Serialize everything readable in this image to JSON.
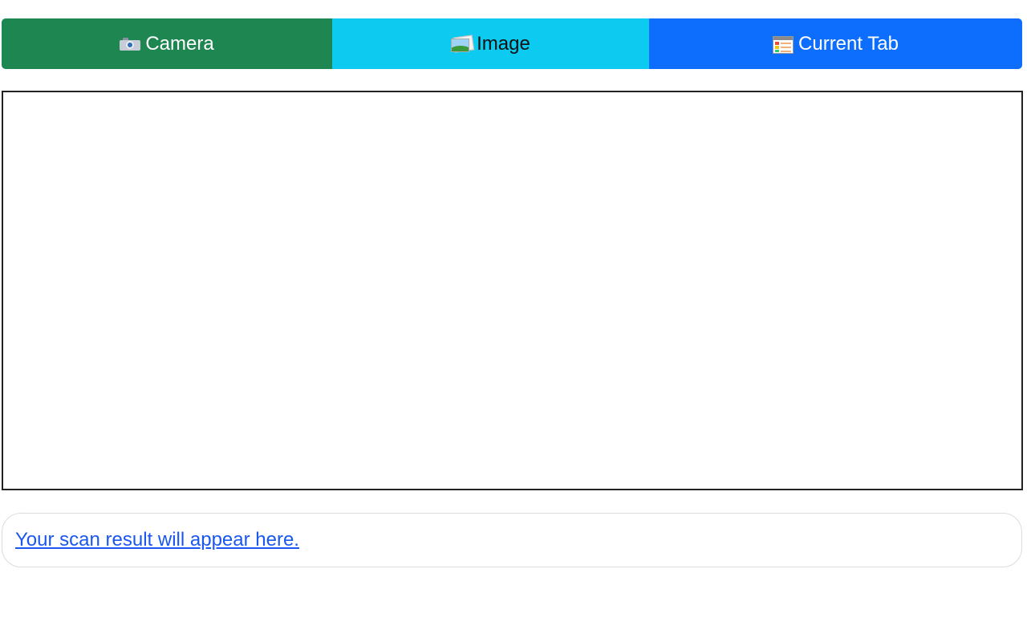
{
  "toolbar": {
    "camera": {
      "label": "Camera",
      "icon": "camera-icon",
      "color": "#1e8650",
      "text_color": "#ffffff"
    },
    "image": {
      "label": "Image",
      "icon": "image-icon",
      "color": "#0dcaf0",
      "text_color": "#111111"
    },
    "current_tab": {
      "label": "Current Tab",
      "icon": "browser-tab-icon",
      "color": "#0d6efd",
      "text_color": "#ffffff"
    }
  },
  "result": {
    "text": "Your scan result will appear here.",
    "link_color": "#1a56f0"
  }
}
